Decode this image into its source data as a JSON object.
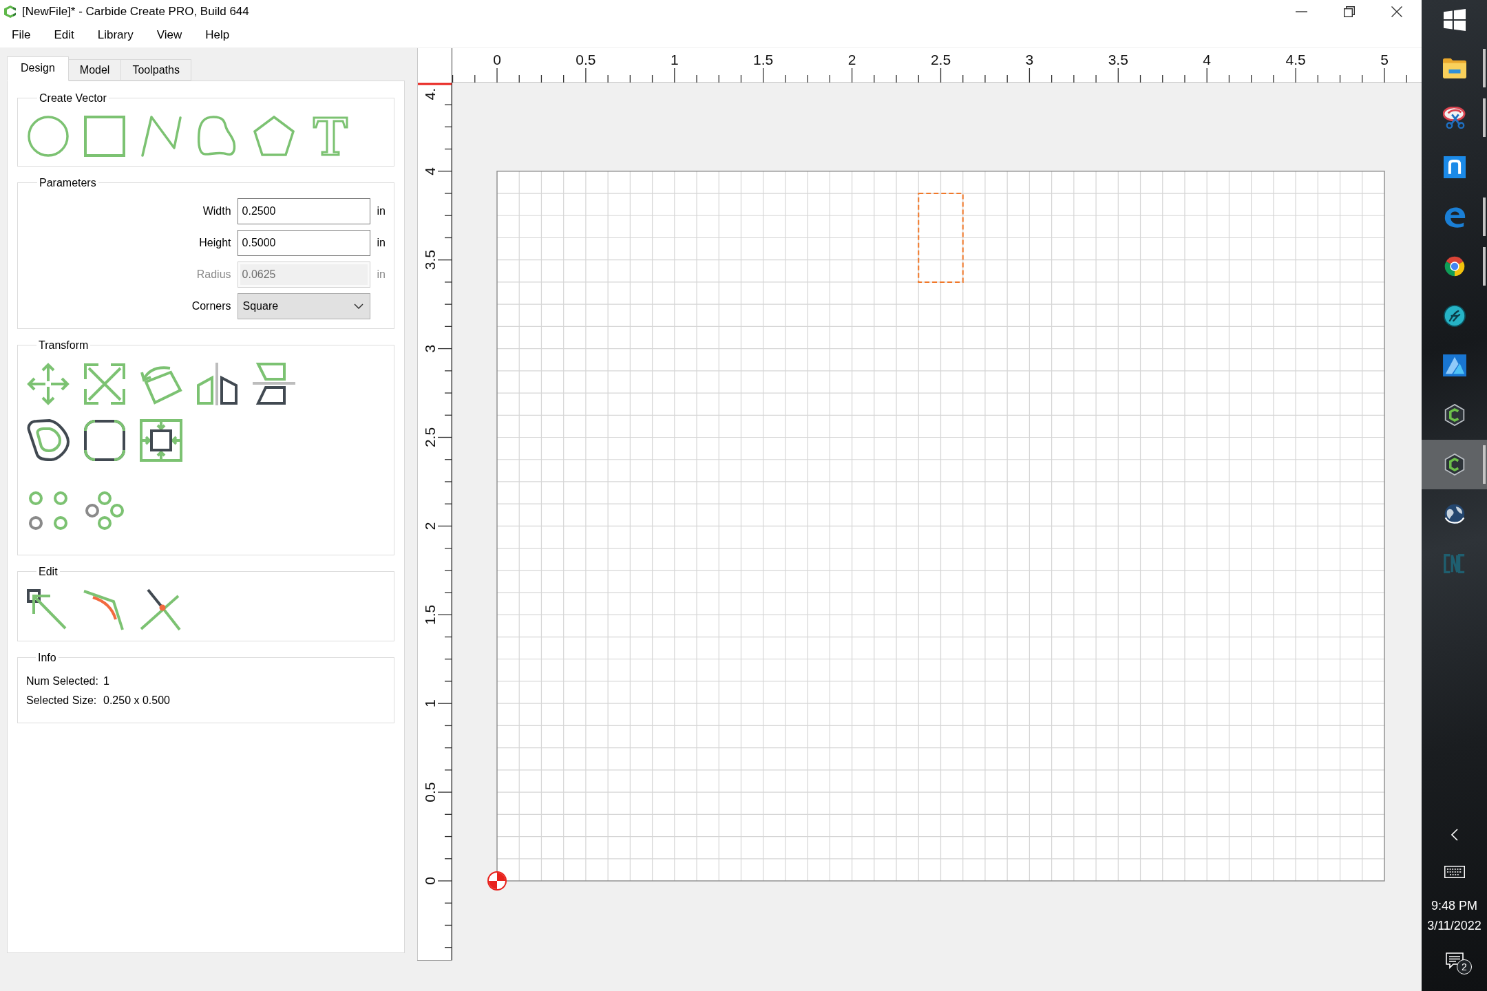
{
  "window": {
    "title": "[NewFile]* - Carbide Create PRO, Build 644"
  },
  "menu": [
    "File",
    "Edit",
    "Library",
    "View",
    "Help"
  ],
  "tabs": [
    {
      "label": "Design",
      "selected": true
    },
    {
      "label": "Model",
      "selected": false
    },
    {
      "label": "Toolpaths",
      "selected": false
    }
  ],
  "create_vector": {
    "title": "Create Vector"
  },
  "parameters": {
    "title": "Parameters",
    "fields": [
      {
        "label": "Width",
        "value": "0.2500",
        "unit": "in",
        "disabled": false
      },
      {
        "label": "Height",
        "value": "0.5000",
        "unit": "in",
        "disabled": false
      },
      {
        "label": "Radius",
        "value": "0.0625",
        "unit": "in",
        "disabled": true
      }
    ],
    "corners": {
      "label": "Corners",
      "value": "Square"
    }
  },
  "transform": {
    "title": "Transform"
  },
  "edit": {
    "title": "Edit"
  },
  "info": {
    "title": "Info",
    "rows": [
      {
        "label": "Num Selected:",
        "value": "1"
      },
      {
        "label": "Selected Size:",
        "value": "0.250 x 0.500"
      }
    ]
  },
  "rulers": {
    "horizontal": [
      "0",
      "0.5",
      "1",
      "1.5",
      "2",
      "2.5",
      "3",
      "3.5",
      "4",
      "4.5",
      "5"
    ],
    "vertical": [
      "0",
      "0.5",
      "1",
      "1.5",
      "2",
      "2.5",
      "3",
      "3.5",
      "4",
      "4."
    ]
  },
  "canvas": {
    "shapes": [
      {
        "kind": "rectangle",
        "selected": true
      }
    ]
  },
  "taskbar": {
    "apps": [
      {
        "running": true,
        "selected": false
      },
      {
        "running": true,
        "selected": false
      },
      {
        "running": false,
        "selected": false
      },
      {
        "running": true,
        "selected": false
      },
      {
        "running": true,
        "selected": false
      },
      {
        "running": false,
        "selected": false
      },
      {
        "running": false,
        "selected": false
      },
      {
        "running": false,
        "selected": false
      },
      {
        "running": true,
        "selected": true
      },
      {
        "running": false,
        "selected": false
      },
      {
        "running": false,
        "selected": false
      }
    ],
    "clock": {
      "time": "9:48 PM",
      "date": "3/11/2022"
    },
    "notifications": {
      "count": "2"
    }
  }
}
